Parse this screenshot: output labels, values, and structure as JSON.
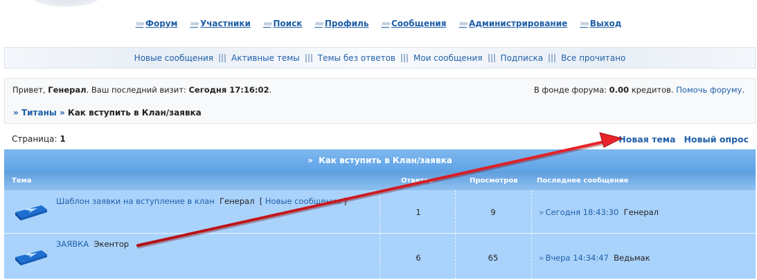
{
  "main_nav": [
    {
      "label": "Форум"
    },
    {
      "label": "Участники"
    },
    {
      "label": "Поиск"
    },
    {
      "label": "Профиль"
    },
    {
      "label": "Сообщения"
    },
    {
      "label": "Администрирование"
    },
    {
      "label": "Выход"
    }
  ],
  "sub_nav": [
    {
      "label": "Новые сообщения"
    },
    {
      "label": "Активные темы"
    },
    {
      "label": "Темы без ответов"
    },
    {
      "label": "Мои сообщения"
    },
    {
      "label": "Подписка"
    },
    {
      "label": "Все прочитано"
    }
  ],
  "info": {
    "greet_prefix": "Привет,",
    "user": "Генерал",
    "visit_prefix": ". Ваш последний визит:",
    "visit_time": "Сегодня 17:16:02",
    "visit_end": ".",
    "fund_prefix": "В фонде форума:",
    "fund_amount": "0.00",
    "fund_suffix": "кредитов.",
    "help_link": "Помочь форуму"
  },
  "breadcrumb": {
    "sep": "»",
    "parent": "Титаны",
    "current": "Как вступить в Клан/заявка"
  },
  "pagination": {
    "label": "Страница:",
    "page": "1"
  },
  "actions": {
    "new_topic": "Новая тема",
    "new_poll": "Новый опрос"
  },
  "table": {
    "title_arrow": "»",
    "title": "Как вступить в Клан/заявка",
    "headers": {
      "topic": "Тема",
      "replies": "Ответов",
      "views": "Просмотров",
      "last": "Последнее сообщение"
    },
    "rows": [
      {
        "title": "Шаблон заявки на вступление в клан",
        "author": "Генерал",
        "bracket_open": "[",
        "tag": "Новые сообщения",
        "bracket_close": "]",
        "replies": "1",
        "views": "9",
        "last_time": "Сегодня 18:43:30",
        "last_author": "Генерал"
      },
      {
        "title": "ЗАЯВКА",
        "author": "Экентор",
        "replies": "6",
        "views": "65",
        "last_time": "Вчера 14:34:47",
        "last_author": "Ведьмак"
      }
    ]
  },
  "colors": {
    "link": "#1f5fa8",
    "table_row": "#aad3fc",
    "annotation_arrow": "#d8141a"
  }
}
